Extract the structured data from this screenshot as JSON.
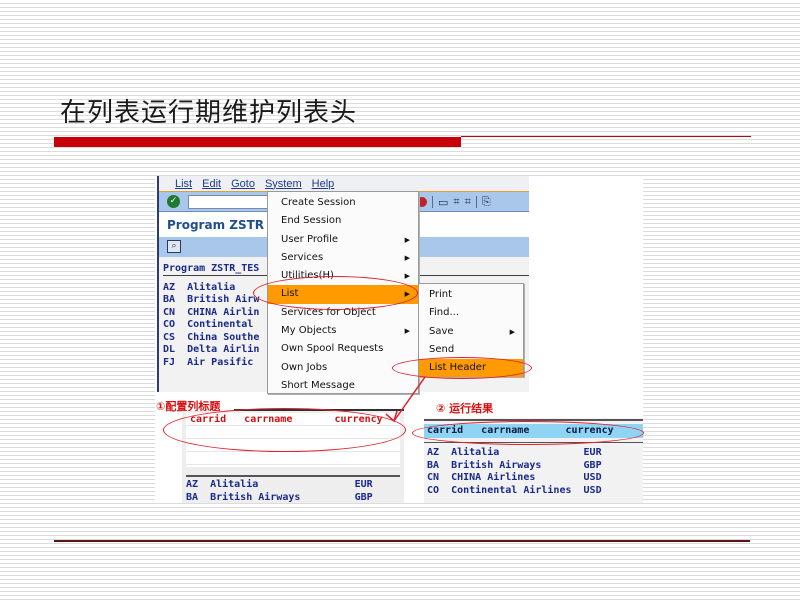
{
  "slide": {
    "title": "在列表运行期维护列表头"
  },
  "sap": {
    "menubar": [
      "List",
      "Edit",
      "Goto",
      "System",
      "Help"
    ],
    "program_title": "Program ZSTR",
    "list_program_header": "Program ZSTR_TES",
    "rows": [
      {
        "code": "AZ",
        "name": "Alitalia"
      },
      {
        "code": "BA",
        "name": "British Airw"
      },
      {
        "code": "CN",
        "name": "CHINA Airlin"
      },
      {
        "code": "CO",
        "name": "Continental"
      },
      {
        "code": "CS",
        "name": "China Southe"
      },
      {
        "code": "DL",
        "name": "Delta Airlin"
      },
      {
        "code": "FJ",
        "name": "Air Pasific"
      }
    ],
    "toolbar_icons": [
      "ok-check-icon",
      "cancel-icon",
      "print-icon",
      "find-icon",
      "find-next-icon",
      "first-page-icon"
    ]
  },
  "system_menu": {
    "items": [
      {
        "label": "Create Session",
        "submenu": false
      },
      {
        "label": "End Session",
        "submenu": false
      },
      {
        "label": "User Profile",
        "submenu": true
      },
      {
        "label": "Services",
        "submenu": true
      },
      {
        "label": "Utilities(H)",
        "submenu": true
      },
      {
        "label": "List",
        "submenu": true,
        "highlighted": true
      },
      {
        "label": "Services for Object",
        "submenu": false
      },
      {
        "label": "My Objects",
        "submenu": true
      },
      {
        "label": "Own Spool Requests",
        "submenu": false
      },
      {
        "label": "Own Jobs",
        "submenu": false
      },
      {
        "label": "Short Message",
        "submenu": false
      }
    ]
  },
  "list_submenu": {
    "items": [
      {
        "label": "Print",
        "submenu": false
      },
      {
        "label": "Find...",
        "submenu": false
      },
      {
        "label": "Save",
        "submenu": true
      },
      {
        "label": "Send",
        "submenu": false
      },
      {
        "label": "List Header",
        "submenu": false,
        "highlighted": true
      }
    ]
  },
  "step1": {
    "label": "①配置列标题",
    "header_line": "carrid   carrname       currency",
    "rows": [
      "AZ  Alitalia                EUR",
      "BA  British Airways         GBP"
    ]
  },
  "step2": {
    "label": "② 运行结果",
    "header_line": "carrid   carrname      currency",
    "rows": [
      "AZ  Alitalia              EUR",
      "BA  British Airways       GBP",
      "CN  CHINA Airlines        USD",
      "CO  Continental Airlines  USD"
    ]
  },
  "colors": {
    "accent_red": "#c8000a",
    "menu_highlight": "#ff9a00",
    "sap_blue": "#a9c7ea",
    "header_result": "#8fd3f5"
  }
}
